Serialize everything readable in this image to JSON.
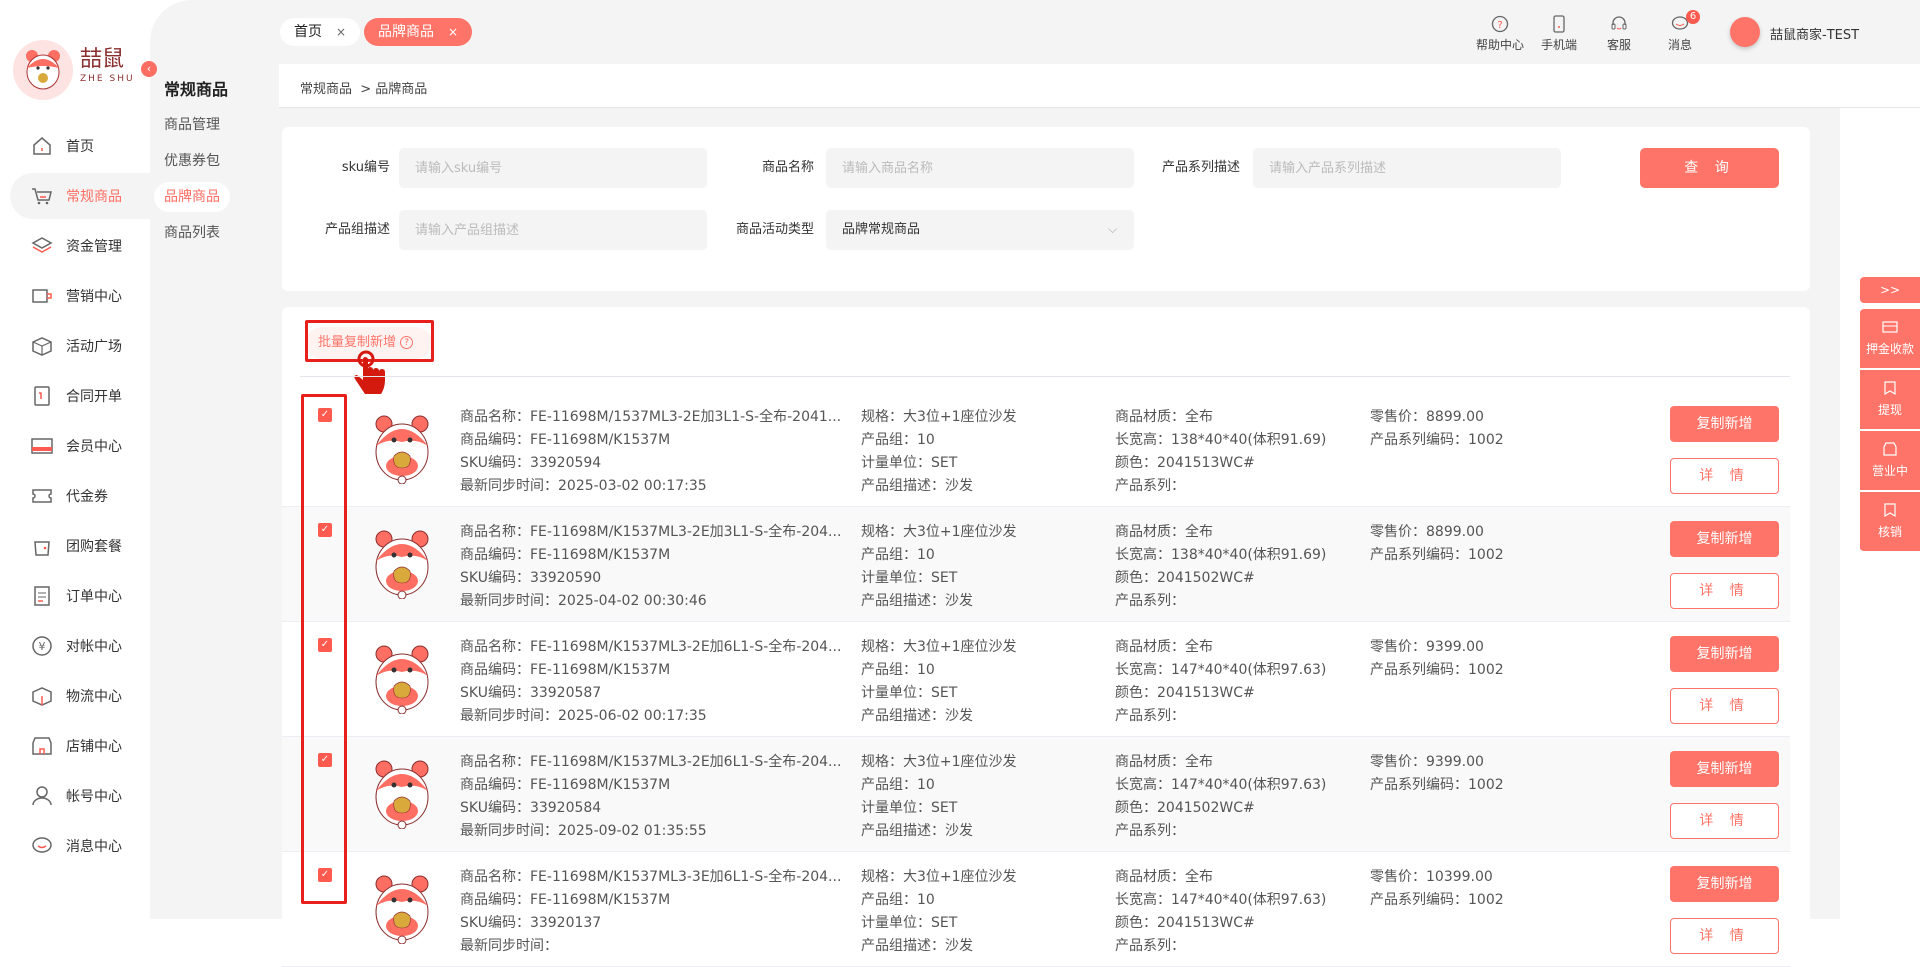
{
  "logo": {
    "text": "喆鼠",
    "sub": "ZHE SHU"
  },
  "sidebar": {
    "items": [
      {
        "label": "首页",
        "icon": "home-icon"
      },
      {
        "label": "常规商品",
        "icon": "cart-icon",
        "active": true
      },
      {
        "label": "资金管理",
        "icon": "layers-icon"
      },
      {
        "label": "营销中心",
        "icon": "marketing-icon"
      },
      {
        "label": "活动广场",
        "icon": "box-icon"
      },
      {
        "label": "合同开单",
        "icon": "contract-icon"
      },
      {
        "label": "会员中心",
        "icon": "vip-card-icon"
      },
      {
        "label": "代金券",
        "icon": "coupon-icon"
      },
      {
        "label": "团购套餐",
        "icon": "bag-icon"
      },
      {
        "label": "订单中心",
        "icon": "order-icon"
      },
      {
        "label": "对帐中心",
        "icon": "yen-icon"
      },
      {
        "label": "物流中心",
        "icon": "package-icon"
      },
      {
        "label": "店铺中心",
        "icon": "shop-icon"
      },
      {
        "label": "帐号中心",
        "icon": "user-icon"
      },
      {
        "label": "消息中心",
        "icon": "message-icon"
      }
    ]
  },
  "submenu": {
    "title": "常规商品",
    "items": [
      "商品管理",
      "优惠券包",
      "品牌商品",
      "商品列表"
    ],
    "active": 2
  },
  "tabs": [
    {
      "label": "首页",
      "close": "×"
    },
    {
      "label": "品牌商品",
      "close": "×"
    }
  ],
  "header": {
    "help": "帮助中心",
    "mobile": "手机端",
    "service": "客服",
    "messages": "消息",
    "message_count": "6",
    "username": "喆鼠商家-TEST"
  },
  "breadcrumb": "常规商品  > 品牌商品",
  "filter": {
    "sku_label": "sku编号",
    "sku_placeholder": "请输入sku编号",
    "name_label": "商品名称",
    "name_placeholder": "请输入商品名称",
    "series_label": "产品系列描述",
    "series_placeholder": "请输入产品系列描述",
    "group_label": "产品组描述",
    "group_placeholder": "请输入产品组描述",
    "activity_label": "商品活动类型",
    "activity_value": "品牌常规商品",
    "query": "查 询"
  },
  "batch_label": "批量复制新增",
  "labels": {
    "name": "商品名称：",
    "code": "商品编码：",
    "sku": "SKU编码：",
    "sync": "最新同步时间：",
    "spec": "规格：",
    "group": "产品组：",
    "unit": "计量单位：",
    "group_desc": "产品组描述：",
    "material": "商品材质：",
    "size": "长宽高：",
    "color": "颜色：",
    "series": "产品系列：",
    "price": "零售价：",
    "series_code": "产品系列编码："
  },
  "products": [
    {
      "name": "FE-11698M/1537ML3-2E加3L1-S-全布-2041...",
      "code": "FE-11698M/K1537M",
      "sku": "33920594",
      "sync": "2025-03-02 00:17:35",
      "spec": "大3位+1座位沙发",
      "group": "10",
      "unit": "SET",
      "group_desc": "沙发",
      "material": "全布",
      "size": "138*40*40(体积91.69)",
      "color": "2041513WC#",
      "series": "",
      "price": "8899.00",
      "series_code": "1002",
      "checked": true
    },
    {
      "name": "FE-11698M/K1537ML3-2E加3L1-S-全布-204...",
      "code": "FE-11698M/K1537M",
      "sku": "33920590",
      "sync": "2025-04-02 00:30:46",
      "spec": "大3位+1座位沙发",
      "group": "10",
      "unit": "SET",
      "group_desc": "沙发",
      "material": "全布",
      "size": "138*40*40(体积91.69)",
      "color": "2041502WC#",
      "series": "",
      "price": "8899.00",
      "series_code": "1002",
      "checked": true
    },
    {
      "name": "FE-11698M/K1537ML3-2E加6L1-S-全布-204...",
      "code": "FE-11698M/K1537M",
      "sku": "33920587",
      "sync": "2025-06-02 00:17:35",
      "spec": "大3位+1座位沙发",
      "group": "10",
      "unit": "SET",
      "group_desc": "沙发",
      "material": "全布",
      "size": "147*40*40(体积97.63)",
      "color": "2041513WC#",
      "series": "",
      "price": "9399.00",
      "series_code": "1002",
      "checked": true
    },
    {
      "name": "FE-11698M/K1537ML3-2E加6L1-S-全布-204...",
      "code": "FE-11698M/K1537M",
      "sku": "33920584",
      "sync": "2025-09-02 01:35:55",
      "spec": "大3位+1座位沙发",
      "group": "10",
      "unit": "SET",
      "group_desc": "沙发",
      "material": "全布",
      "size": "147*40*40(体积97.63)",
      "color": "2041502WC#",
      "series": "",
      "price": "9399.00",
      "series_code": "1002",
      "checked": true
    },
    {
      "name": "FE-11698M/K1537ML3-3E加6L1-S-全布-204...",
      "code": "FE-11698M/K1537M",
      "sku": "33920137",
      "sync": "",
      "spec": "大3位+1座位沙发",
      "group": "10",
      "unit": "SET",
      "group_desc": "沙发",
      "material": "全布",
      "size": "147*40*40(体积97.63)",
      "color": "2041513WC#",
      "series": "",
      "price": "10399.00",
      "series_code": "1002",
      "checked": true
    }
  ],
  "row_actions": {
    "copy": "复制新增",
    "detail": "详 情"
  },
  "right_panel": {
    "toggle": ">>",
    "items": [
      {
        "label": "押金收款",
        "icon": "card-icon"
      },
      {
        "label": "提现",
        "icon": "bookmark-icon"
      },
      {
        "label": "营业中",
        "icon": "store-icon"
      },
      {
        "label": "核销",
        "icon": "bookmark-icon"
      }
    ]
  },
  "colors": {
    "accent": "#ff7468",
    "highlight": "#e8201c",
    "bg": "#f4f4f4"
  }
}
